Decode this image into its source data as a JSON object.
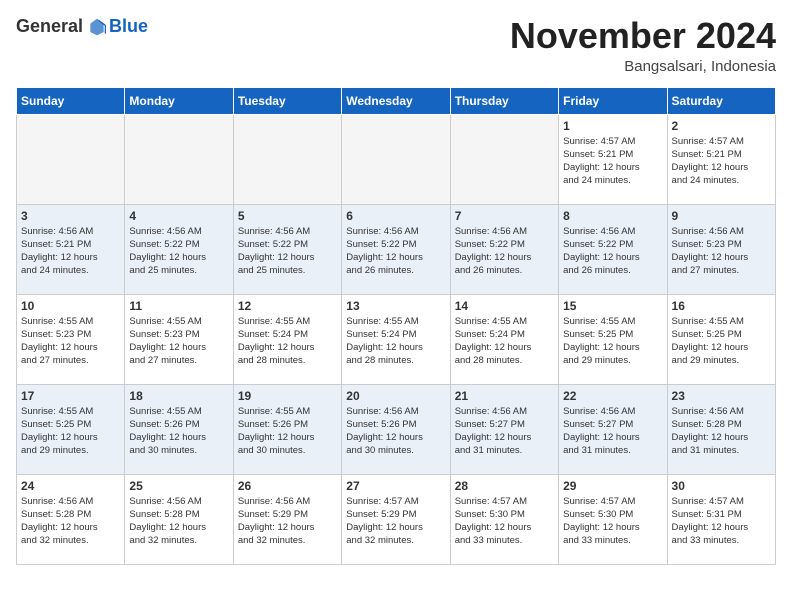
{
  "logo": {
    "general": "General",
    "blue": "Blue"
  },
  "header": {
    "month": "November 2024",
    "location": "Bangsalsari, Indonesia"
  },
  "weekdays": [
    "Sunday",
    "Monday",
    "Tuesday",
    "Wednesday",
    "Thursday",
    "Friday",
    "Saturday"
  ],
  "weeks": [
    [
      {
        "day": "",
        "info": ""
      },
      {
        "day": "",
        "info": ""
      },
      {
        "day": "",
        "info": ""
      },
      {
        "day": "",
        "info": ""
      },
      {
        "day": "",
        "info": ""
      },
      {
        "day": "1",
        "info": "Sunrise: 4:57 AM\nSunset: 5:21 PM\nDaylight: 12 hours\nand 24 minutes."
      },
      {
        "day": "2",
        "info": "Sunrise: 4:57 AM\nSunset: 5:21 PM\nDaylight: 12 hours\nand 24 minutes."
      }
    ],
    [
      {
        "day": "3",
        "info": "Sunrise: 4:56 AM\nSunset: 5:21 PM\nDaylight: 12 hours\nand 24 minutes."
      },
      {
        "day": "4",
        "info": "Sunrise: 4:56 AM\nSunset: 5:22 PM\nDaylight: 12 hours\nand 25 minutes."
      },
      {
        "day": "5",
        "info": "Sunrise: 4:56 AM\nSunset: 5:22 PM\nDaylight: 12 hours\nand 25 minutes."
      },
      {
        "day": "6",
        "info": "Sunrise: 4:56 AM\nSunset: 5:22 PM\nDaylight: 12 hours\nand 26 minutes."
      },
      {
        "day": "7",
        "info": "Sunrise: 4:56 AM\nSunset: 5:22 PM\nDaylight: 12 hours\nand 26 minutes."
      },
      {
        "day": "8",
        "info": "Sunrise: 4:56 AM\nSunset: 5:22 PM\nDaylight: 12 hours\nand 26 minutes."
      },
      {
        "day": "9",
        "info": "Sunrise: 4:56 AM\nSunset: 5:23 PM\nDaylight: 12 hours\nand 27 minutes."
      }
    ],
    [
      {
        "day": "10",
        "info": "Sunrise: 4:55 AM\nSunset: 5:23 PM\nDaylight: 12 hours\nand 27 minutes."
      },
      {
        "day": "11",
        "info": "Sunrise: 4:55 AM\nSunset: 5:23 PM\nDaylight: 12 hours\nand 27 minutes."
      },
      {
        "day": "12",
        "info": "Sunrise: 4:55 AM\nSunset: 5:24 PM\nDaylight: 12 hours\nand 28 minutes."
      },
      {
        "day": "13",
        "info": "Sunrise: 4:55 AM\nSunset: 5:24 PM\nDaylight: 12 hours\nand 28 minutes."
      },
      {
        "day": "14",
        "info": "Sunrise: 4:55 AM\nSunset: 5:24 PM\nDaylight: 12 hours\nand 28 minutes."
      },
      {
        "day": "15",
        "info": "Sunrise: 4:55 AM\nSunset: 5:25 PM\nDaylight: 12 hours\nand 29 minutes."
      },
      {
        "day": "16",
        "info": "Sunrise: 4:55 AM\nSunset: 5:25 PM\nDaylight: 12 hours\nand 29 minutes."
      }
    ],
    [
      {
        "day": "17",
        "info": "Sunrise: 4:55 AM\nSunset: 5:25 PM\nDaylight: 12 hours\nand 29 minutes."
      },
      {
        "day": "18",
        "info": "Sunrise: 4:55 AM\nSunset: 5:26 PM\nDaylight: 12 hours\nand 30 minutes."
      },
      {
        "day": "19",
        "info": "Sunrise: 4:55 AM\nSunset: 5:26 PM\nDaylight: 12 hours\nand 30 minutes."
      },
      {
        "day": "20",
        "info": "Sunrise: 4:56 AM\nSunset: 5:26 PM\nDaylight: 12 hours\nand 30 minutes."
      },
      {
        "day": "21",
        "info": "Sunrise: 4:56 AM\nSunset: 5:27 PM\nDaylight: 12 hours\nand 31 minutes."
      },
      {
        "day": "22",
        "info": "Sunrise: 4:56 AM\nSunset: 5:27 PM\nDaylight: 12 hours\nand 31 minutes."
      },
      {
        "day": "23",
        "info": "Sunrise: 4:56 AM\nSunset: 5:28 PM\nDaylight: 12 hours\nand 31 minutes."
      }
    ],
    [
      {
        "day": "24",
        "info": "Sunrise: 4:56 AM\nSunset: 5:28 PM\nDaylight: 12 hours\nand 32 minutes."
      },
      {
        "day": "25",
        "info": "Sunrise: 4:56 AM\nSunset: 5:28 PM\nDaylight: 12 hours\nand 32 minutes."
      },
      {
        "day": "26",
        "info": "Sunrise: 4:56 AM\nSunset: 5:29 PM\nDaylight: 12 hours\nand 32 minutes."
      },
      {
        "day": "27",
        "info": "Sunrise: 4:57 AM\nSunset: 5:29 PM\nDaylight: 12 hours\nand 32 minutes."
      },
      {
        "day": "28",
        "info": "Sunrise: 4:57 AM\nSunset: 5:30 PM\nDaylight: 12 hours\nand 33 minutes."
      },
      {
        "day": "29",
        "info": "Sunrise: 4:57 AM\nSunset: 5:30 PM\nDaylight: 12 hours\nand 33 minutes."
      },
      {
        "day": "30",
        "info": "Sunrise: 4:57 AM\nSunset: 5:31 PM\nDaylight: 12 hours\nand 33 minutes."
      }
    ]
  ]
}
